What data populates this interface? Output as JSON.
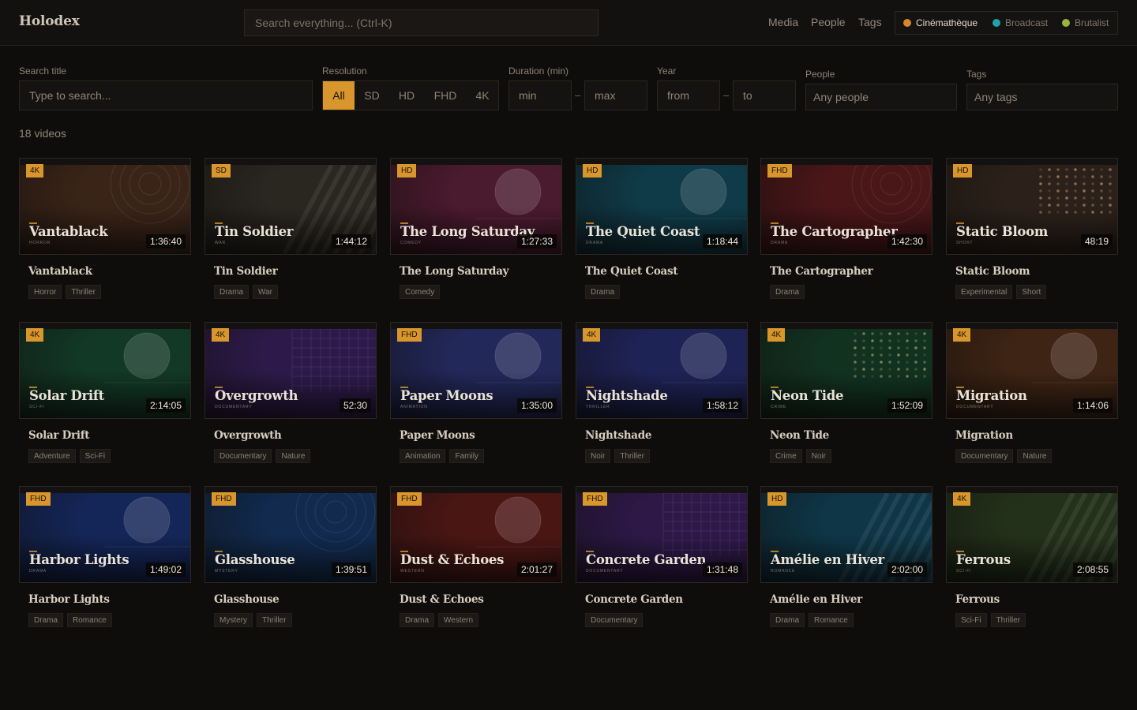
{
  "app": {
    "name": "Holodex"
  },
  "search": {
    "placeholder": "Search everything... (Ctrl-K)"
  },
  "nav": {
    "media": "Media",
    "people": "People",
    "tags": "Tags"
  },
  "themes": [
    {
      "label": "Cinémathèque",
      "color": "#d8862c",
      "active": true
    },
    {
      "label": "Broadcast",
      "color": "#1fa3a8",
      "active": false
    },
    {
      "label": "Brutalist",
      "color": "#9ab640",
      "active": false
    }
  ],
  "filters": {
    "title_label": "Search title",
    "title_placeholder": "Type to search...",
    "resolution_label": "Resolution",
    "resolutions": [
      "All",
      "SD",
      "HD",
      "FHD",
      "4K"
    ],
    "resolution_selected": "All",
    "duration_label": "Duration (min)",
    "duration_min_placeholder": "min",
    "duration_max_placeholder": "max",
    "year_label": "Year",
    "year_from_placeholder": "from",
    "year_to_placeholder": "to",
    "people_label": "People",
    "people_placeholder": "Any people",
    "tags_label": "Tags",
    "tags_placeholder": "Any tags",
    "range_separator": "–"
  },
  "results_count": "18 videos",
  "videos": [
    {
      "title": "Vantablack",
      "res": "4K",
      "duration": "1:36:40",
      "genre": "Horror",
      "tags": [
        "Horror",
        "Thriller"
      ],
      "color": "#3a2418",
      "deco": "rings"
    },
    {
      "title": "Tin Soldier",
      "res": "SD",
      "duration": "1:44:12",
      "genre": "War",
      "tags": [
        "Drama",
        "War"
      ],
      "color": "#2a2620",
      "deco": "stripes"
    },
    {
      "title": "The Long Saturday",
      "res": "HD",
      "duration": "1:27:33",
      "genre": "Comedy",
      "tags": [
        "Comedy"
      ],
      "color": "#4a1a2e",
      "deco": "circle"
    },
    {
      "title": "The Quiet Coast",
      "res": "HD",
      "duration": "1:18:44",
      "genre": "Drama",
      "tags": [
        "Drama"
      ],
      "color": "#0f3a48",
      "deco": "circle"
    },
    {
      "title": "The Cartographer",
      "res": "FHD",
      "duration": "1:42:30",
      "genre": "Drama",
      "tags": [
        "Drama"
      ],
      "color": "#4a1618",
      "deco": "rings"
    },
    {
      "title": "Static Bloom",
      "res": "HD",
      "duration": "48:19",
      "genre": "Short",
      "tags": [
        "Experimental",
        "Short"
      ],
      "color": "#2c211a",
      "deco": "dots"
    },
    {
      "title": "Solar Drift",
      "res": "4K",
      "duration": "2:14:05",
      "genre": "Sci-Fi",
      "tags": [
        "Adventure",
        "Sci-Fi"
      ],
      "color": "#123826",
      "deco": "circle"
    },
    {
      "title": "Overgrowth",
      "res": "4K",
      "duration": "52:30",
      "genre": "Documentary",
      "tags": [
        "Documentary",
        "Nature"
      ],
      "color": "#2e1a4a",
      "deco": "grid"
    },
    {
      "title": "Paper Moons",
      "res": "FHD",
      "duration": "1:35:00",
      "genre": "Animation",
      "tags": [
        "Animation",
        "Family"
      ],
      "color": "#22285a",
      "deco": "circle"
    },
    {
      "title": "Nightshade",
      "res": "4K",
      "duration": "1:58:12",
      "genre": "Thriller",
      "tags": [
        "Noir",
        "Thriller"
      ],
      "color": "#1e2356",
      "deco": "circle"
    },
    {
      "title": "Neon Tide",
      "res": "4K",
      "duration": "1:52:09",
      "genre": "Crime",
      "tags": [
        "Crime",
        "Noir"
      ],
      "color": "#123220",
      "deco": "dots"
    },
    {
      "title": "Migration",
      "res": "4K",
      "duration": "1:14:06",
      "genre": "Documentary",
      "tags": [
        "Documentary",
        "Nature"
      ],
      "color": "#3e2414",
      "deco": "circle"
    },
    {
      "title": "Harbor Lights",
      "res": "FHD",
      "duration": "1:49:02",
      "genre": "Drama",
      "tags": [
        "Drama",
        "Romance"
      ],
      "color": "#142658",
      "deco": "circle"
    },
    {
      "title": "Glasshouse",
      "res": "FHD",
      "duration": "1:39:51",
      "genre": "Mystery",
      "tags": [
        "Mystery",
        "Thriller"
      ],
      "color": "#112a4e",
      "deco": "rings"
    },
    {
      "title": "Dust & Echoes",
      "res": "FHD",
      "duration": "2:01:27",
      "genre": "Western",
      "tags": [
        "Drama",
        "Western"
      ],
      "color": "#4a1614",
      "deco": "circle"
    },
    {
      "title": "Concrete Garden",
      "res": "FHD",
      "duration": "1:31:48",
      "genre": "Documentary",
      "tags": [
        "Documentary"
      ],
      "color": "#2e1848",
      "deco": "grid"
    },
    {
      "title": "Amélie en Hiver",
      "res": "HD",
      "duration": "2:02:00",
      "genre": "Romance",
      "tags": [
        "Drama",
        "Romance"
      ],
      "color": "#0e3646",
      "deco": "stripes"
    },
    {
      "title": "Ferrous",
      "res": "4K",
      "duration": "2:08:55",
      "genre": "Sci-Fi",
      "tags": [
        "Sci-Fi",
        "Thriller"
      ],
      "color": "#23311a",
      "deco": "stripes"
    }
  ]
}
